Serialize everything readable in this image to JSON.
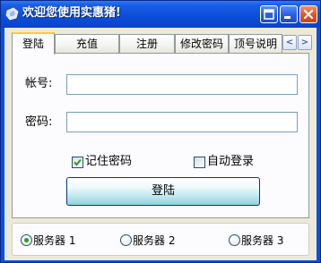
{
  "window": {
    "title": "欢迎您使用实惠猪!"
  },
  "tabs": [
    {
      "label": "登陆",
      "active": true
    },
    {
      "label": "充值",
      "active": false
    },
    {
      "label": "注册",
      "active": false
    },
    {
      "label": "修改密码",
      "active": false
    },
    {
      "label": "顶号说明",
      "active": false
    }
  ],
  "tab_scroll": {
    "left": "<",
    "right": ">"
  },
  "login_form": {
    "account_label": "帐号:",
    "account_value": "",
    "password_label": "密码:",
    "password_value": "",
    "remember_password": {
      "label": "记住密码",
      "checked": true
    },
    "auto_login": {
      "label": "自动登录",
      "checked": false
    },
    "submit_label": "登陆"
  },
  "servers": [
    {
      "label": "服务器 1",
      "selected": true
    },
    {
      "label": "服务器 2",
      "selected": false
    },
    {
      "label": "服务器 3",
      "selected": false
    }
  ],
  "colors": {
    "titlebar": "#0c4fd8",
    "window_face": "#ece9d8",
    "active_tab_accent": "#ffc83c",
    "checkmark": "#21a121",
    "close_button": "#e05a2c"
  },
  "icons": {
    "app": "app-icon",
    "restore": "restore-icon",
    "minimize": "minimize-icon",
    "close": "close-icon"
  }
}
